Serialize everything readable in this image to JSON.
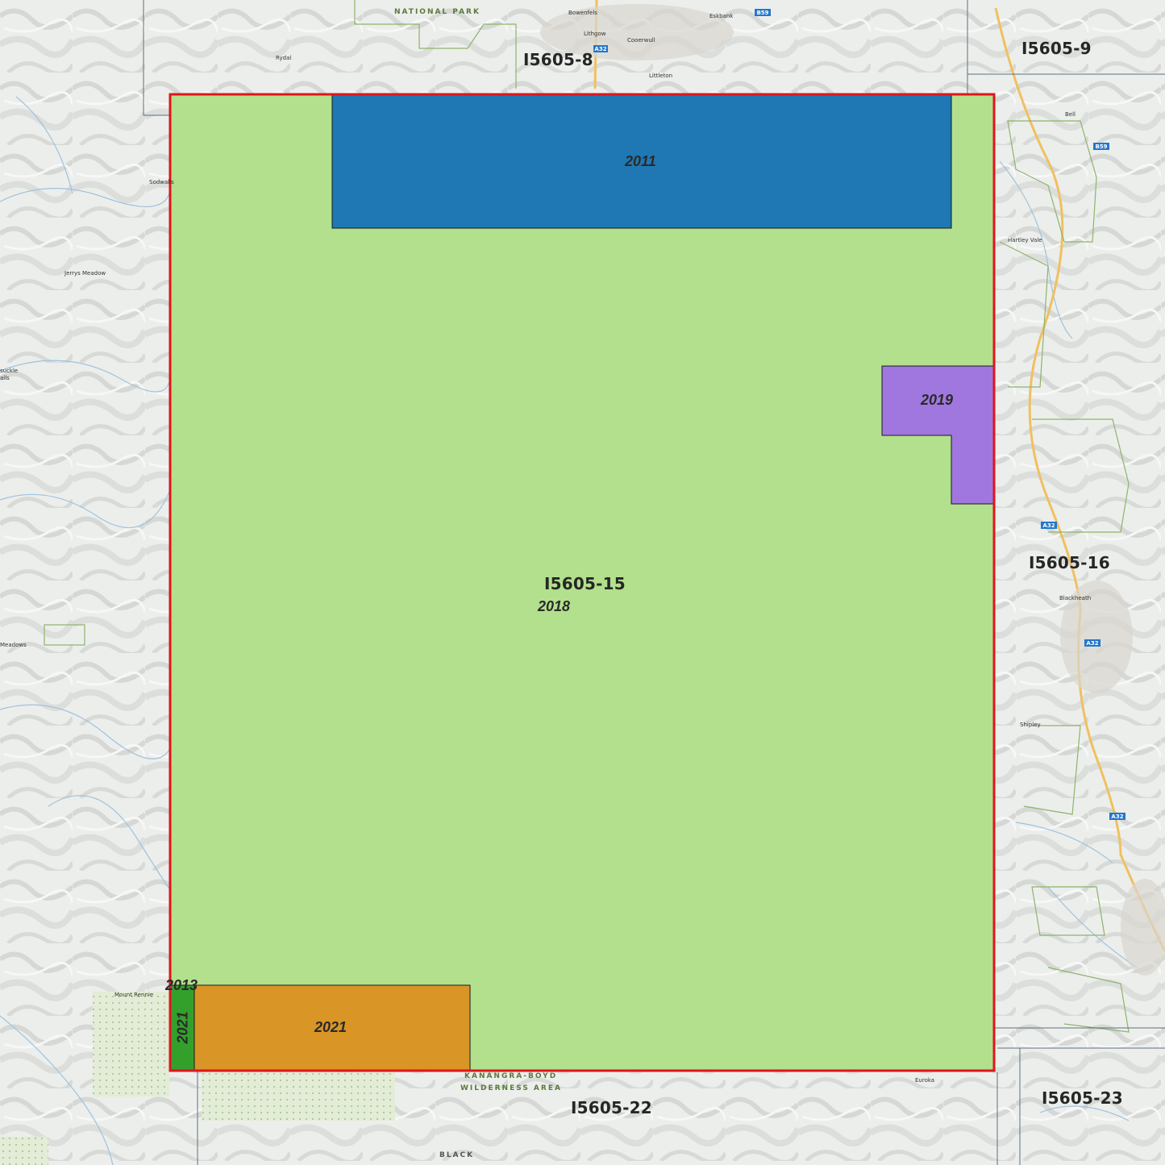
{
  "tile_labels": {
    "center": "I5605-15",
    "north": "I5605-8",
    "north_east": "I5605-9",
    "east": "I5605-16",
    "south": "I5605-22",
    "south_east": "I5605-23"
  },
  "coverage_years": {
    "base": "2018",
    "top_block": "2011",
    "east_block": "2019",
    "south_block": "2021",
    "strip_block": "2021",
    "strip_top": "2013"
  },
  "colors": {
    "base": "#b3e08d",
    "top_block": "#1f78b4",
    "east_block": "#a077de",
    "south_block": "#d99526",
    "strip_block": "#33a02c",
    "outline": "#e0141c"
  },
  "place_labels": {
    "wallerawang": "Bowenfels",
    "eskbank": "Eskbank",
    "lithgow": "Lithgow",
    "cooerwull": "Cooerwull",
    "littleton": "Littleton",
    "rydal": "Rydal",
    "bell": "Bell",
    "hartley_vale": "Hartley Vale",
    "blackheath": "Blackheath",
    "shipley": "Shipley",
    "euroka": "Euroka",
    "mount_rennie": "Mount Rennie",
    "meadows": "Meadows",
    "jerrys": "Jerrys Meadow",
    "sodwalls": "Sodwalls",
    "honeysuckle": "suckle",
    "falls": "alls"
  },
  "area_labels": {
    "marrangaroo": "NATIONAL PARK",
    "kanangra_1": "KANANGRA-BOYD",
    "kanangra_2": "WILDERNESS AREA",
    "black": "BLACK"
  },
  "road_badges": [
    "A32",
    "B59",
    "B59",
    "A32",
    "A32",
    "A32"
  ]
}
